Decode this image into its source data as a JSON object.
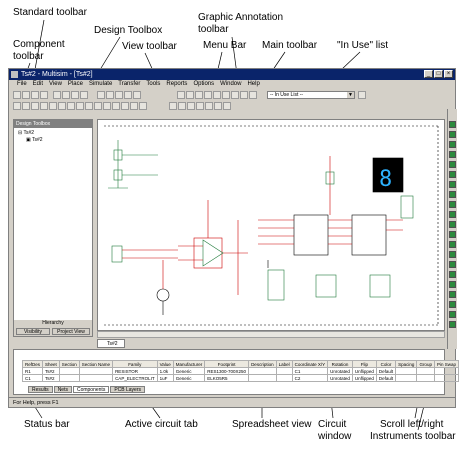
{
  "annotations": {
    "standard_toolbar": "Standard toolbar",
    "design_toolbox": "Design Toolbox",
    "graphic_annotation_1": "Graphic Annotation",
    "graphic_annotation_2": "toolbar",
    "component_toolbar_1": "Component",
    "component_toolbar_2": "toolbar",
    "view_toolbar": "View toolbar",
    "menu_bar": "Menu Bar",
    "main_toolbar": "Main toolbar",
    "in_use_list": "\"In Use\" list",
    "status_bar": "Status bar",
    "active_circuit_tab": "Active circuit tab",
    "spreadsheet_view": "Spreadsheet view",
    "circuit_window_1": "Circuit",
    "circuit_window_2": "window",
    "scroll_lr": "Scroll left/right",
    "instruments_toolbar": "Instruments toolbar"
  },
  "window": {
    "title": "Ts#2 - Multisim - [Ts#2]",
    "menu": [
      "File",
      "Edit",
      "View",
      "Place",
      "Simulate",
      "Transfer",
      "Tools",
      "Reports",
      "Options",
      "Window",
      "Help"
    ],
    "in_use_value": "-- In Use List --"
  },
  "toolbox": {
    "header": "Design Toolbox",
    "tree_root": "Ts#2",
    "tree_child": "Ts#2",
    "footer_label": "Hierarchy",
    "tab_visibility": "Visibility",
    "tab_project": "Project View"
  },
  "circuit_tab": "Ts#2",
  "spreadsheet": {
    "headers": [
      "RefDes",
      "Sheet",
      "Section",
      "Section Name",
      "Family",
      "Value",
      "Manufacturer",
      "Footprint",
      "Description",
      "Label",
      "Coordinate X/Y",
      "Rotation",
      "Flip",
      "Color",
      "Spacing",
      "Group",
      "Pin Swap"
    ],
    "rows": [
      [
        "R1",
        "Ts#2",
        "",
        "",
        "RESISTOR",
        "1.0k",
        "Generic",
        "RES1300-700X250",
        "",
        "",
        "C1",
        "Unrotated",
        "Unflipped",
        "Default",
        "",
        "",
        ""
      ],
      [
        "C1",
        "Ts#2",
        "",
        "",
        "CAP_ELECTROLIT",
        "1uF",
        "Generic",
        "ELKO5R5",
        "",
        "",
        "C2",
        "Unrotated",
        "Unflipped",
        "Default",
        "",
        "",
        ""
      ]
    ],
    "tabs": [
      "Results",
      "Nets",
      "Components",
      "PCB Layers"
    ]
  },
  "status": "For Help, press F1"
}
